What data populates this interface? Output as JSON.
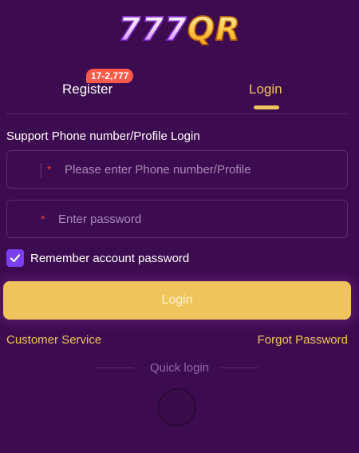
{
  "logo": {
    "digits": "777",
    "letters": "QR"
  },
  "tabs": {
    "register_label": "Register",
    "register_badge": "17-2,777",
    "login_label": "Login"
  },
  "form": {
    "title": "Support Phone number/Profile Login",
    "phone_placeholder": "Please enter Phone number/Profile",
    "password_placeholder": "Enter password",
    "required_mark": "*",
    "remember_label": "Remember account password",
    "remember_checked": true,
    "login_button": "Login"
  },
  "links": {
    "customer_service": "Customer Service",
    "forgot_password": "Forgot Password"
  },
  "quick_login": {
    "label": "Quick login"
  },
  "colors": {
    "background": "#3d0b4f",
    "accent": "#f0c45c",
    "badge": "#ff5a4a",
    "checkbox": "#7a3ff0",
    "required": "#e0413f"
  }
}
